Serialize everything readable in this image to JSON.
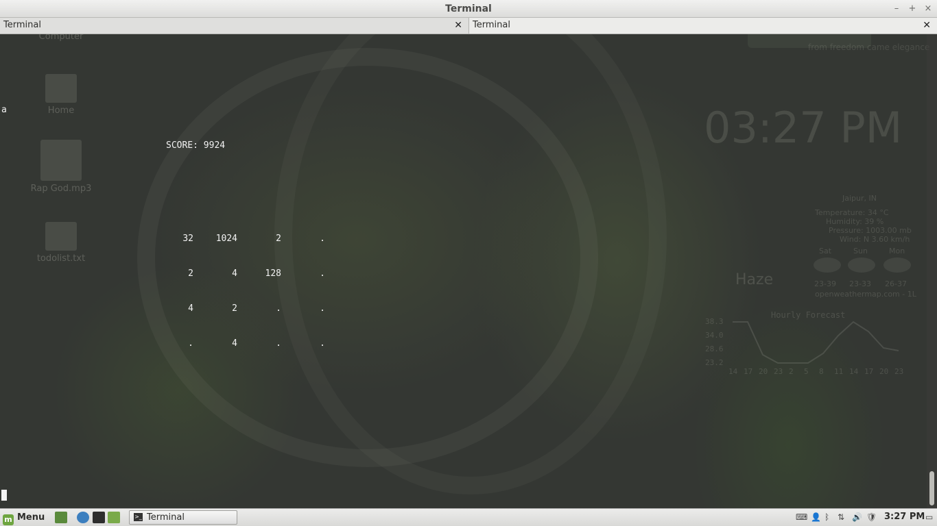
{
  "window": {
    "title": "Terminal",
    "minimize_glyph": "–",
    "maximize_glyph": "+",
    "close_glyph": "×"
  },
  "tabs": [
    {
      "label": "Terminal",
      "close_glyph": "✕"
    },
    {
      "label": "Terminal",
      "close_glyph": "✕"
    }
  ],
  "terminal": {
    "first_line": "a",
    "score_text": "SCORE: 9924",
    "board": [
      [
        "32",
        "1024",
        "2",
        "."
      ],
      [
        "2",
        "4",
        "128",
        "."
      ],
      [
        "4",
        "2",
        ".",
        "."
      ],
      [
        ".",
        "4",
        ".",
        "."
      ]
    ]
  },
  "desktop_background": {
    "icons": [
      "Computer",
      "Home",
      "Rap God.mp3",
      "todolist.txt"
    ],
    "clock_text": "03:27 PM",
    "brand_text": "from freedom came elegance",
    "weather": {
      "location": "Jaipur, IN",
      "temperature": "Temperature: 34 °C",
      "humidity": "Humidity: 39 %",
      "pressure": "Pressure: 1003.00 mb",
      "wind": "Wind: N 3.60 km/h",
      "condition": "Haze",
      "days": [
        "Sat",
        "Sun",
        "Mon"
      ],
      "ranges": [
        "23-39",
        "23-33",
        "26-37"
      ],
      "source": "openweathermap.com - 1L",
      "forecast_title": "Hourly Forecast",
      "forecast_y_ticks": [
        "38.3",
        "34.0",
        "28.6",
        "23.2"
      ],
      "forecast_x_ticks": [
        "14",
        "17",
        "20",
        "23",
        "2",
        "5",
        "8",
        "11",
        "14",
        "17",
        "20",
        "23"
      ]
    }
  },
  "taskbar": {
    "menu_label": "Menu",
    "window_button_label": "Terminal",
    "clock": "3:27 PM"
  },
  "colors": {
    "terminal_bg": "#343733",
    "terminal_fg": "#f2f2f2",
    "mint_green": "#6ea540"
  }
}
